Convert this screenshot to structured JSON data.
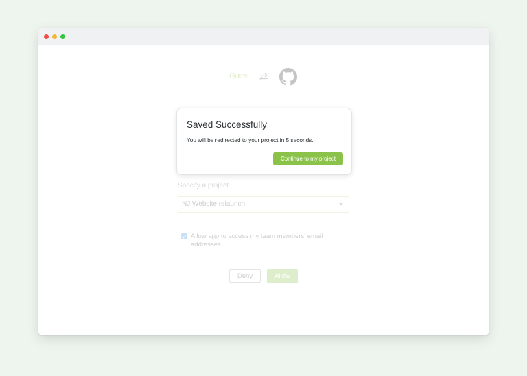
{
  "window": {
    "traffic_lights": [
      "close",
      "minimize",
      "zoom"
    ]
  },
  "brand": {
    "app_name": "Guire",
    "swap_icon": "swap-arrows-icon",
    "provider_icon": "github-icon"
  },
  "modal": {
    "title": "Saved Successfully",
    "message": "You will be redirected to your project in 5 seconds.",
    "button_label": "Continue to my project"
  },
  "form": {
    "project_label": "Specify a project",
    "project_value": "NJ Website relaunch",
    "checkbox_checked": true,
    "checkbox_label": "Allow app to access my team members' email addresses",
    "deny_label": "Deny",
    "allow_label": "Allow"
  },
  "colors": {
    "accent": "#8bc34a",
    "checkbox": "#3d8fe0",
    "background": "#eef4ee"
  }
}
